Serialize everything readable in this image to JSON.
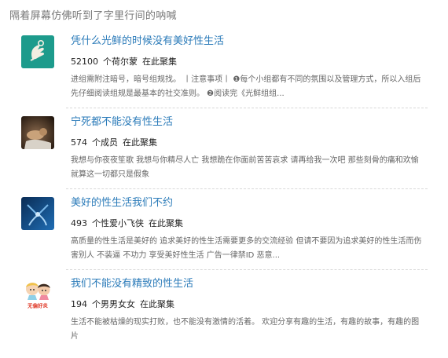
{
  "page": {
    "heading": "隔着屏幕仿佛听到了字里行间的呐喊"
  },
  "groups": [
    {
      "title": "凭什么光鲜的时候没有美好性生活",
      "count": "52100",
      "member_name": "个荷尔蒙",
      "gather": "在此聚集",
      "description": "进组需附注暗号，暗号组规找。 丨注意事项丨 ❶每个小组都有不同的氛围以及管理方式，所以入组后先仔细阅读组规是最基本的社交准则。 ❷阅读完《光鲜组组...",
      "thumb_icon": "hand-sign-icon",
      "thumb_colors": [
        "#1fa090",
        "#f2eee2"
      ]
    },
    {
      "title": "宁死都不能没有性生活",
      "count": "574",
      "member_name": "个成员",
      "gather": "在此聚集",
      "description": "我想与你夜夜笙歌 我想与你精尽人亡 我想跪在你面前苦苦哀求 请再给我一次吧 那些刻骨的痛和欢愉 就算这一切都只是假象",
      "thumb_icon": "couple-photo-icon",
      "thumb_colors": [
        "#3a2a1e",
        "#c9a27a"
      ]
    },
    {
      "title": "美好的性生活我们不约",
      "count": "493",
      "member_name": "个性爱小飞侠",
      "gather": "在此聚集",
      "description": "高质量的性生活是美好的 追求美好的性生活需要更多的交流经验 但请不要因为追求美好的性生活而伤害别人 不装逼 不功力 享受美好性生活 广告一律禁ID 恶意...",
      "thumb_icon": "blue-hand-photo-icon",
      "thumb_colors": [
        "#0c3a6e",
        "#79b8ea"
      ]
    },
    {
      "title": "我们不能没有精致的性生活",
      "count": "194",
      "member_name": "个男男女女",
      "gather": "在此聚集",
      "description": "生活不能被枯燥的现实打败，也不能没有激情的活着。 欢迎分享有趣的生活，有趣的故事，有趣的图片",
      "thumb_icon": "cartoon-kids-icon",
      "thumb_text": "无偏好炎",
      "thumb_colors": [
        "#f3d9c8",
        "#e03b2a"
      ]
    }
  ]
}
